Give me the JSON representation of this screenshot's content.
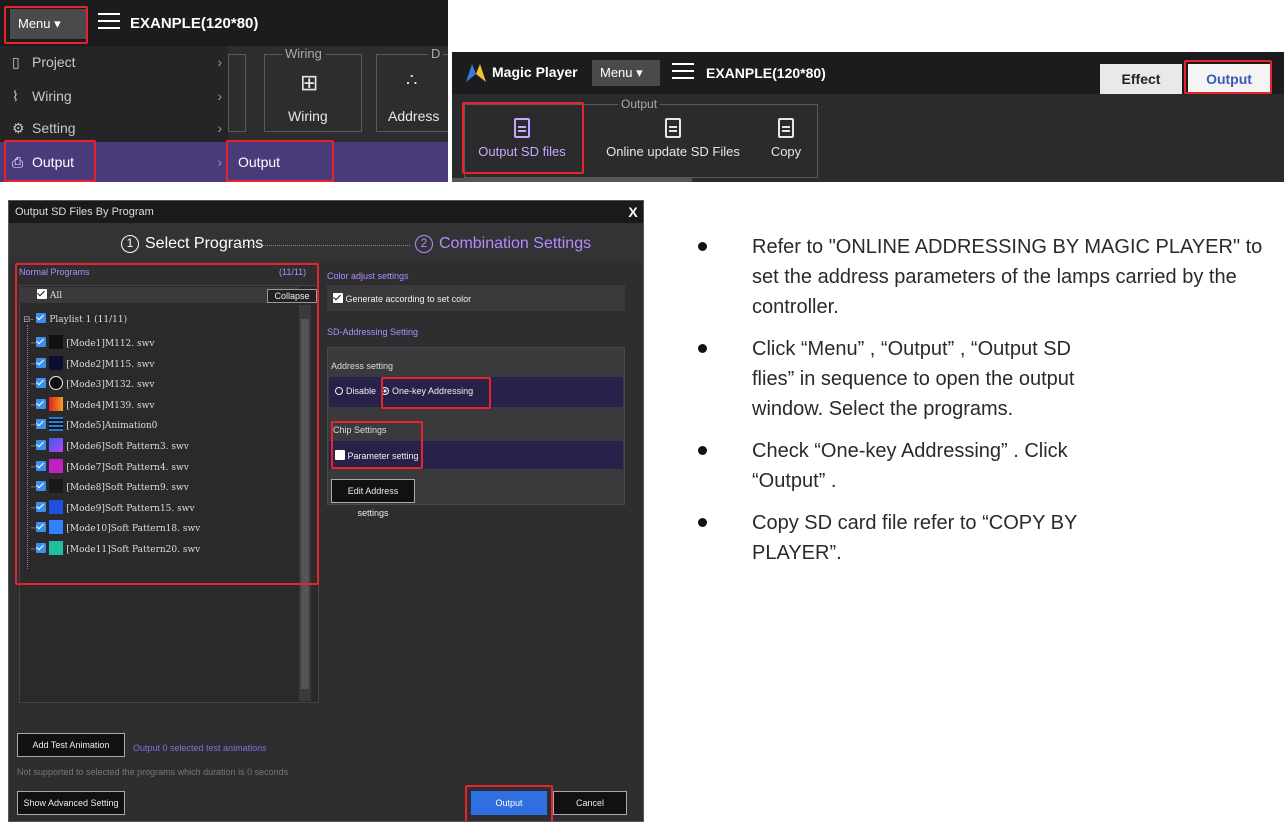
{
  "panel_menu": {
    "menu_button": "Menu ▾",
    "title": "EXANPLE(120*80)",
    "items": [
      {
        "label": "Project",
        "icon": "document-icon"
      },
      {
        "label": "Wiring",
        "icon": "wiring-icon"
      },
      {
        "label": "Setting",
        "icon": "gear-icon"
      },
      {
        "label": "Output",
        "icon": "printer-icon"
      }
    ],
    "ribbon_group_wiring": "Wiring",
    "ribbon_group_cut": "D",
    "ribbon_wiring_label": "Wiring",
    "ribbon_address_label": "Address",
    "submenu_output": "Output"
  },
  "panel_toolbar": {
    "app_name": "Magic Player",
    "menu_button": "Menu ▾",
    "title": "EXANPLE(120*80)",
    "tab_effect": "Effect",
    "tab_output": "Output",
    "group_output": "Output",
    "buttons": [
      "Output SD files",
      "Online update SD Files",
      "Copy"
    ]
  },
  "dialog": {
    "title": "Output SD Files By Program",
    "close": "X",
    "step1_num": "1",
    "step1": "Select Programs",
    "step2_num": "2",
    "step2": "Combination Settings",
    "normal_programs": "Normal Programs",
    "program_count": "(11/11)",
    "all_label": "All",
    "collapse": "Collapse",
    "playlist": "Playlist 1 (11/11)",
    "programs": [
      "[Mode1]M112. swv",
      "[Mode2]M115. swv",
      "[Mode3]M132. swv",
      "[Mode4]M139. swv",
      "[Mode5]Animation0",
      "[Mode6]Soft Pattern3. swv",
      "[Mode7]Soft Pattern4. swv",
      "[Mode8]Soft Pattern9. swv",
      "[Mode9]Soft Pattern15. swv",
      "[Mode10]Soft Pattern18. swv",
      "[Mode11]Soft Pattern20. swv"
    ],
    "color_adjust": "Color adjust settings",
    "generate_color": "Generate according to set color",
    "sd_addressing": "SD-Addressing Setting",
    "address_setting": "Address setting",
    "disable": "Disable",
    "one_key": "One-key Addressing",
    "chip_settings": "Chip Settings",
    "parameter": "Parameter setting",
    "edit_address": "Edit Address settings",
    "add_test": "Add Test Animation",
    "test_info": "Output 0 selected test animations",
    "not_supported": "Not supported to selected the programs which duration is 0 seconds",
    "show_advanced": "Show Advanced Setting",
    "output_btn": "Output",
    "cancel_btn": "Cancel"
  },
  "instructions": [
    "Refer to \"ONLINE ADDRESSING BY MAGIC PLAYER\" to set the address parameters of  the lamps carried by the controller.",
    "Click “Menu” , “Output” , “Output SD flies” in sequence to open the output window. Select the programs.",
    "Check “One-key Addressing” . Click “Output” .",
    "Copy SD card file refer to “COPY BY PLAYER”."
  ]
}
